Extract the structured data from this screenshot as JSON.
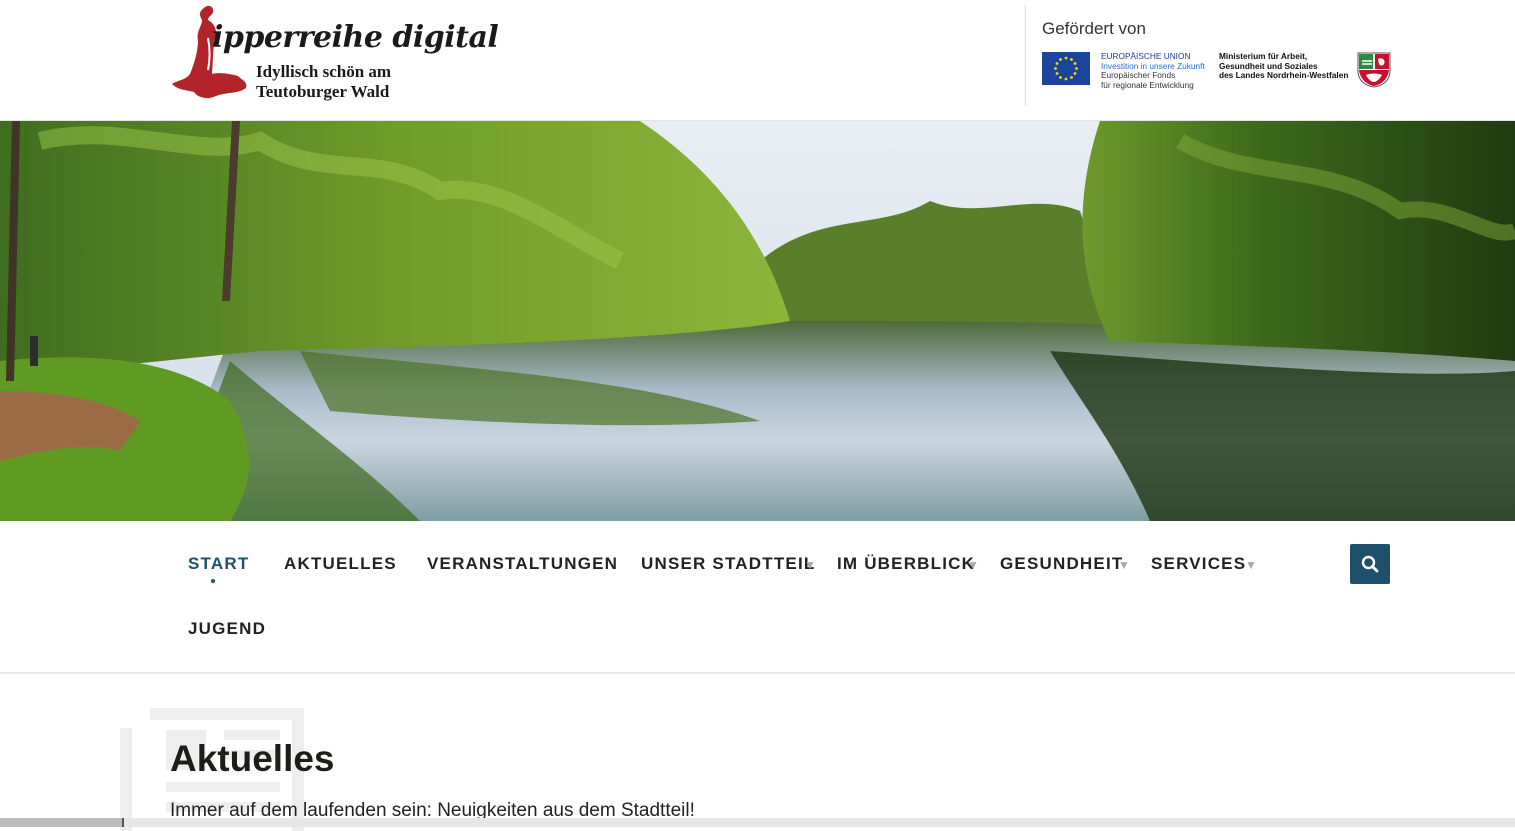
{
  "header": {
    "logo": {
      "title": "ipperreihe digital",
      "subtitle_line1": "Idyllisch schön am",
      "subtitle_line2": "Teutoburger Wald",
      "brand_color": "#b3242a"
    },
    "sponsor": {
      "label": "Gefördert von",
      "eu_line1": "EUROPÄISCHE UNION",
      "eu_line2": "Investition in unsere Zukunft",
      "eu_line3": "Europäischer Fonds",
      "eu_line4": "für regionale Entwicklung",
      "ministry_line1": "Ministerium für Arbeit,",
      "ministry_line2": "Gesundheit und Soziales",
      "ministry_line3": "des Landes Nordrhein-Westfalen"
    }
  },
  "nav": {
    "accent_color": "#1e4f6b",
    "items": [
      {
        "label": "START",
        "active": true
      },
      {
        "label": "AKTUELLES"
      },
      {
        "label": "VERANSTALTUNGEN"
      },
      {
        "label": "UNSER STADTTEIL",
        "dropdown": true
      },
      {
        "label": "IM ÜBERBLICK",
        "dropdown": true
      },
      {
        "label": "GESUNDHEIT",
        "dropdown": true
      },
      {
        "label": "SERVICES",
        "dropdown": true
      },
      {
        "label": "JUGEND"
      }
    ],
    "caret": "▼",
    "search_icon": "search-icon"
  },
  "main": {
    "title": "Aktuelles",
    "subtitle": "Immer auf dem laufenden sein: Neuigkeiten aus dem Stadtteil!",
    "bg_icon": "newspaper-icon"
  }
}
